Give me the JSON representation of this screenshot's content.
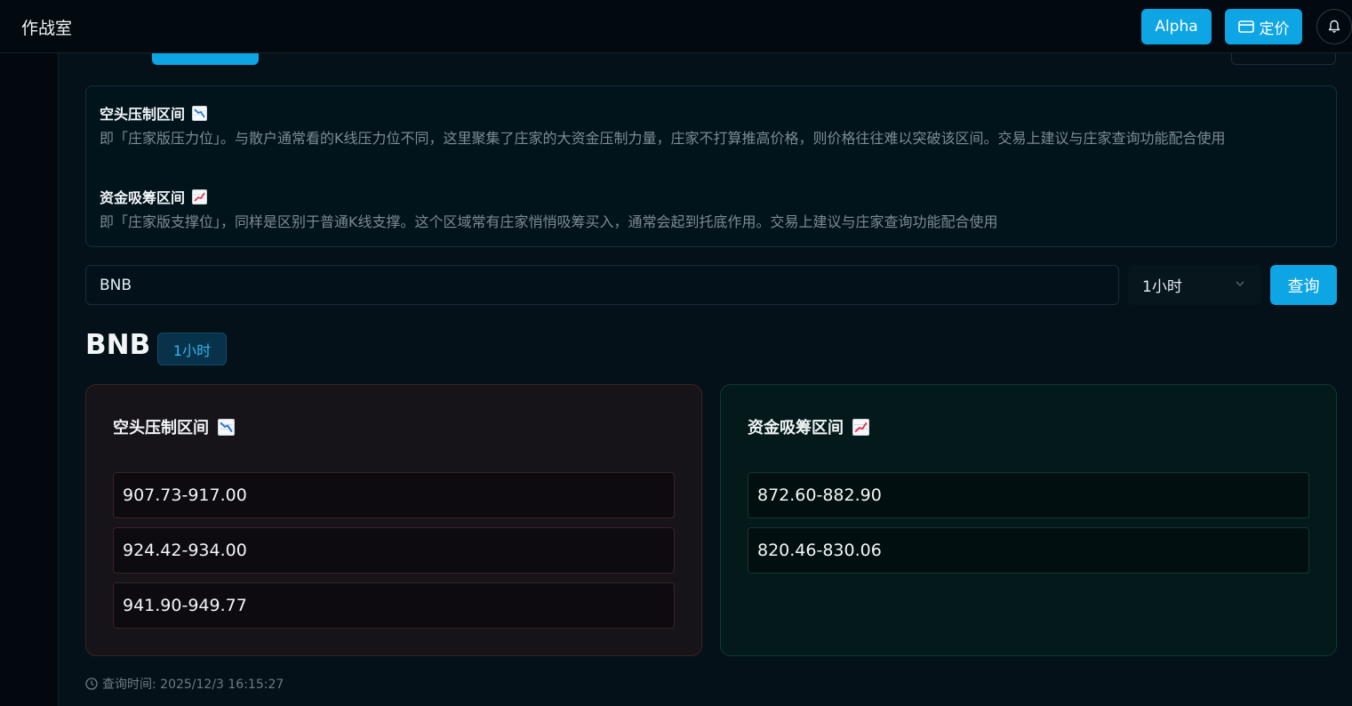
{
  "app": {
    "title": "作战室"
  },
  "header": {
    "alpha_label": "Alpha",
    "pricing_label": "定价"
  },
  "info": {
    "resistance_title": "空头压制区间",
    "resistance_desc": "即「庄家版压力位」。与散户通常看的K线压力位不同，这里聚集了庄家的大资金压制力量，庄家不打算推高价格，则价格往往难以突破该区间。交易上建议与庄家查询功能配合使用",
    "support_title": "资金吸筹区间",
    "support_desc": "即「庄家版支撑位」，同样是区别于普通K线支撑。这个区域常有庄家悄悄吸筹买入，通常会起到托底作用。交易上建议与庄家查询功能配合使用"
  },
  "search": {
    "value": "BNB",
    "interval": "1小时",
    "query_label": "查询"
  },
  "result": {
    "symbol": "BNB",
    "interval": "1小时",
    "resistance": {
      "title": "空头压制区间",
      "ranges": [
        "907.73-917.00",
        "924.42-934.00",
        "941.90-949.77"
      ]
    },
    "support": {
      "title": "资金吸筹区间",
      "ranges": [
        "872.60-882.90",
        "820.46-830.06"
      ]
    },
    "query_time": "查询时间: 2025/12/3 16:15:27"
  },
  "colors": {
    "accent": "#0ea5e4",
    "resistance_card": "#161319",
    "support_card": "#04191a"
  }
}
